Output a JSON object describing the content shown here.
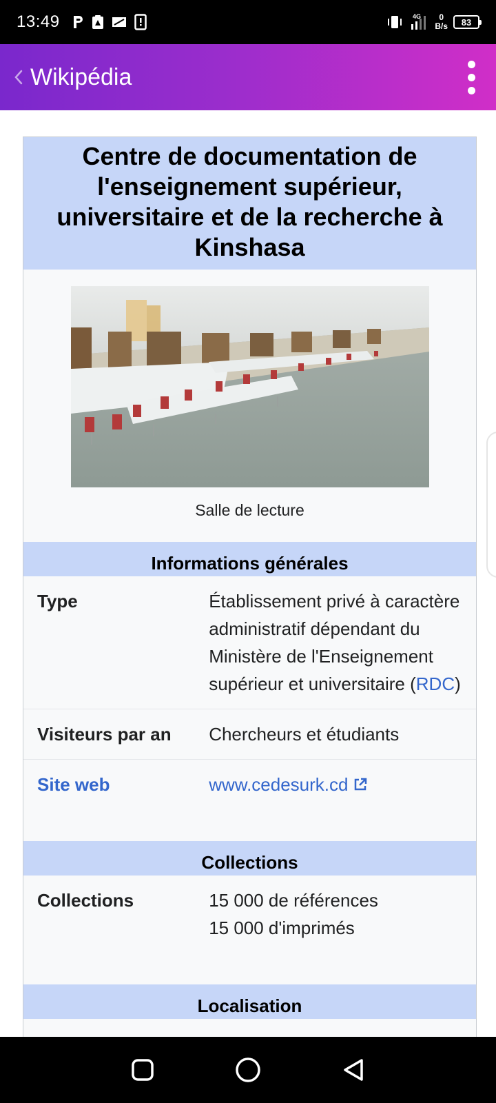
{
  "status_bar": {
    "time": "13:49",
    "net_speed_value": "0",
    "net_speed_unit": "B/s",
    "network_type": "4G",
    "battery": "83"
  },
  "app_bar": {
    "title": "Wikipédia"
  },
  "infobox": {
    "title": "Centre de documentation de l'enseignement supérieur, universitaire et de la recherche à Kinshasa",
    "image_caption": "Salle de lecture",
    "sections": {
      "general": "Informations générales",
      "collections": "Collections",
      "location": "Localisation"
    },
    "rows": {
      "type": {
        "label": "Type",
        "value_text": "Établissement privé à caractère administratif dépendant du Ministère de l'Enseignement supérieur et universitaire (",
        "value_link": "RDC",
        "value_end": ")"
      },
      "visitors": {
        "label": "Visiteurs par an",
        "value": "Chercheurs et étudiants"
      },
      "website": {
        "label": "Site web",
        "value": "www.cedesurk.cd"
      },
      "collections": {
        "label": "Collections",
        "line1": "15 000 de références",
        "line2": "15 000 d'imprimés"
      }
    }
  },
  "colors": {
    "infobox_header": "#c6d6f8",
    "link": "#3366cc",
    "app_bar_start": "#7a28cc",
    "app_bar_end": "#d02ec8"
  }
}
